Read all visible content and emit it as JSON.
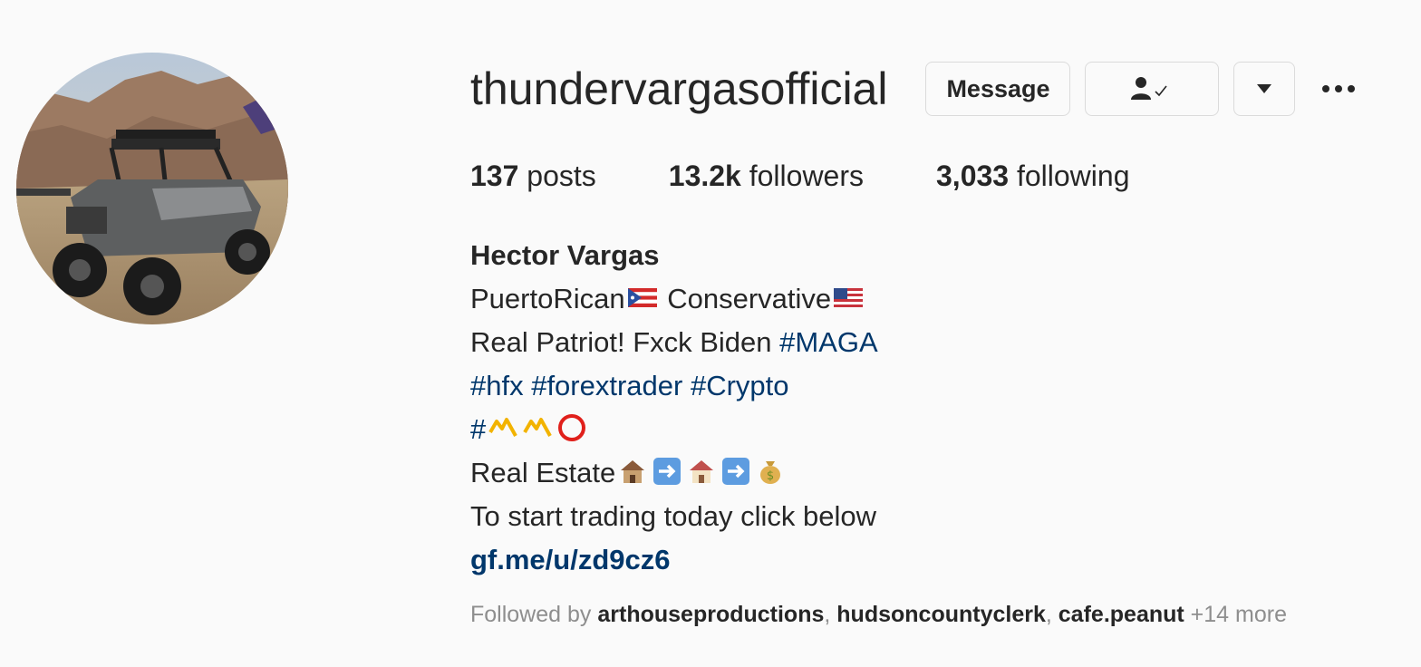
{
  "profile": {
    "username": "thundervargasofficial",
    "avatar_icon": "profile-photo-utv"
  },
  "actions": {
    "message_label": "Message",
    "following_icon": "person-check-icon",
    "dropdown_icon": "caret-down-icon",
    "more_icon": "more-dots-icon"
  },
  "stats": {
    "posts_count": "137",
    "posts_label": " posts",
    "followers_count": "13.2k",
    "followers_label": " followers",
    "following_count": "3,033",
    "following_label": " following"
  },
  "bio": {
    "full_name": "Hector Vargas",
    "line1_a": "PuertoRican",
    "line1_b": " Conservative",
    "line2_text": "Real Patriot! Fxck Biden ",
    "line2_tag": "#MAGA",
    "line3_tags": "#hfx #forextrader #Crypto",
    "line4_hash": "#",
    "line5_text": "Real Estate",
    "line6_text": "To start trading today click below",
    "link": "gf.me/u/zd9cz6"
  },
  "followed_by": {
    "prefix": "Followed by ",
    "user1": "arthouseproductions",
    "sep1": ", ",
    "user2": "hudsoncountyclerk",
    "sep2": ", ",
    "user3": "cafe.peanut",
    "suffix": " +14 more"
  },
  "colors": {
    "background": "#fafafa",
    "text": "#262626",
    "link": "#00376b",
    "muted": "#8e8e8e",
    "border": "#dbdbdb"
  }
}
